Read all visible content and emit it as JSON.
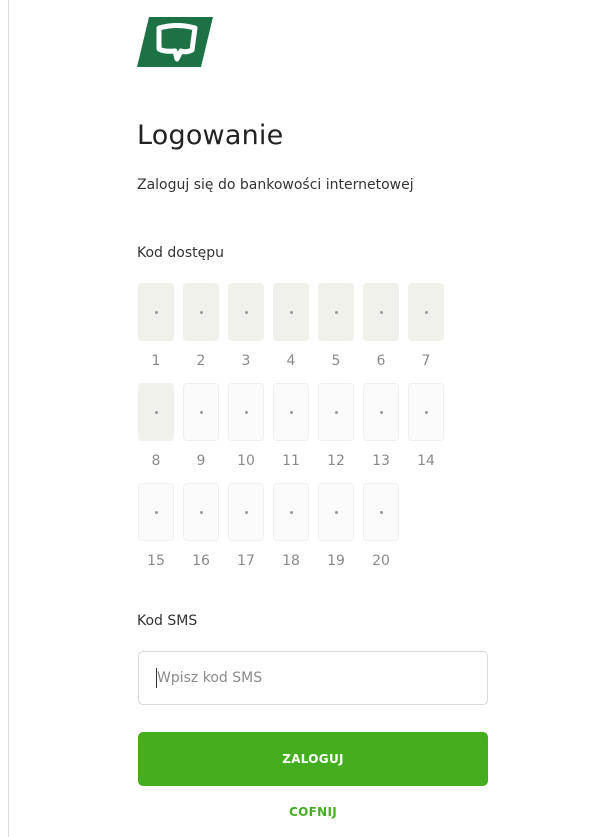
{
  "brand": {
    "logo_icon": "bank-logo-icon",
    "logo_color": "#1d7245"
  },
  "login": {
    "title": "Logowanie",
    "subtitle": "Zaloguj się do bankowości internetowej"
  },
  "access_code": {
    "label": "Kod dostępu",
    "positions": [
      "1",
      "2",
      "3",
      "4",
      "5",
      "6",
      "7",
      "8",
      "9",
      "10",
      "11",
      "12",
      "13",
      "14",
      "15",
      "16",
      "17",
      "18",
      "19",
      "20"
    ],
    "active_positions": [
      "1",
      "2",
      "3",
      "4",
      "5",
      "6",
      "7",
      "8"
    ]
  },
  "sms": {
    "label": "Kod SMS",
    "placeholder": "Wpisz kod SMS",
    "value": ""
  },
  "actions": {
    "login_label": "ZALOGUJ",
    "back_label": "COFNIJ"
  },
  "colors": {
    "accent": "#44ae1f",
    "logo": "#1d7245"
  }
}
